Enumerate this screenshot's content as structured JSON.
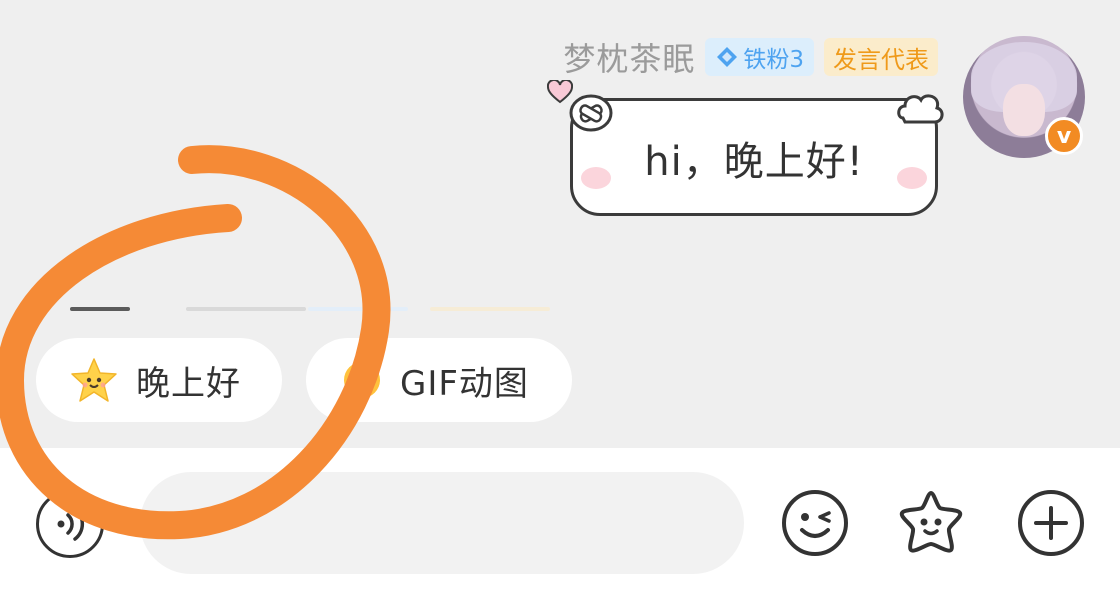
{
  "message": {
    "username": "梦枕茶眠",
    "fan_badge": "铁粉3",
    "role_badge": "发言代表",
    "text": "hi，晚上好!"
  },
  "suggestions": [
    {
      "label": "晚上好",
      "icon": "star-emoji-icon"
    },
    {
      "label": "GIF动图",
      "icon": "gif-icon"
    }
  ],
  "input": {
    "value": "",
    "placeholder": ""
  },
  "toolbar": {
    "voice_icon": "voice-icon",
    "emoji_icon": "wink-emoji-icon",
    "sticker_icon": "star-sticker-icon",
    "plus_icon": "plus-icon"
  },
  "annotation": {
    "color": "#f58a36"
  },
  "colors": {
    "fan_badge_bg": "#dceefc",
    "fan_badge_text": "#4ea3f0",
    "role_badge_bg": "#fbeccb",
    "role_badge_text": "#ef9a1a",
    "verified": "#f28b23"
  }
}
